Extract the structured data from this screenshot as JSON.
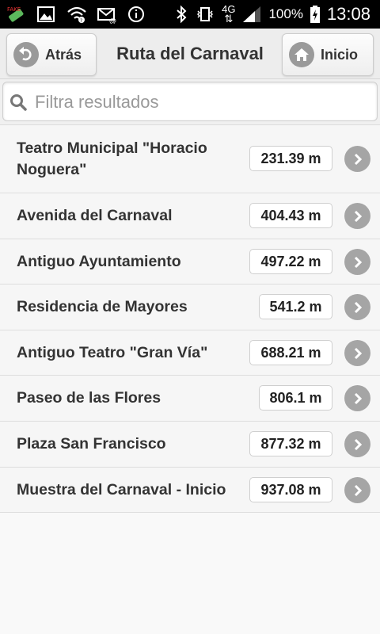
{
  "status_bar": {
    "icons": [
      "app-notification-icon",
      "image-icon",
      "wifi-icon",
      "email-icon",
      "info-icon",
      "bluetooth-icon",
      "vibrate-icon",
      "network-4g-icon",
      "signal-icon",
      "battery-icon"
    ],
    "network": "4G",
    "battery": "100%",
    "time": "13:08"
  },
  "header": {
    "back_label": "Atrás",
    "title": "Ruta del Carnaval",
    "home_label": "Inicio"
  },
  "search": {
    "placeholder": "Filtra resultados",
    "value": ""
  },
  "list": {
    "items": [
      {
        "name": "Teatro Municipal \"Horacio Noguera\"",
        "distance": "231.39 m"
      },
      {
        "name": "Avenida del Carnaval",
        "distance": "404.43 m"
      },
      {
        "name": "Antiguo Ayuntamiento",
        "distance": "497.22 m"
      },
      {
        "name": "Residencia de Mayores",
        "distance": "541.2 m"
      },
      {
        "name": "Antiguo Teatro \"Gran Vía\"",
        "distance": "688.21 m"
      },
      {
        "name": "Paseo de las Flores",
        "distance": "806.1 m"
      },
      {
        "name": "Plaza San Francisco",
        "distance": "877.32 m"
      },
      {
        "name": "Muestra del Carnaval - Inicio",
        "distance": "937.08 m"
      }
    ]
  }
}
